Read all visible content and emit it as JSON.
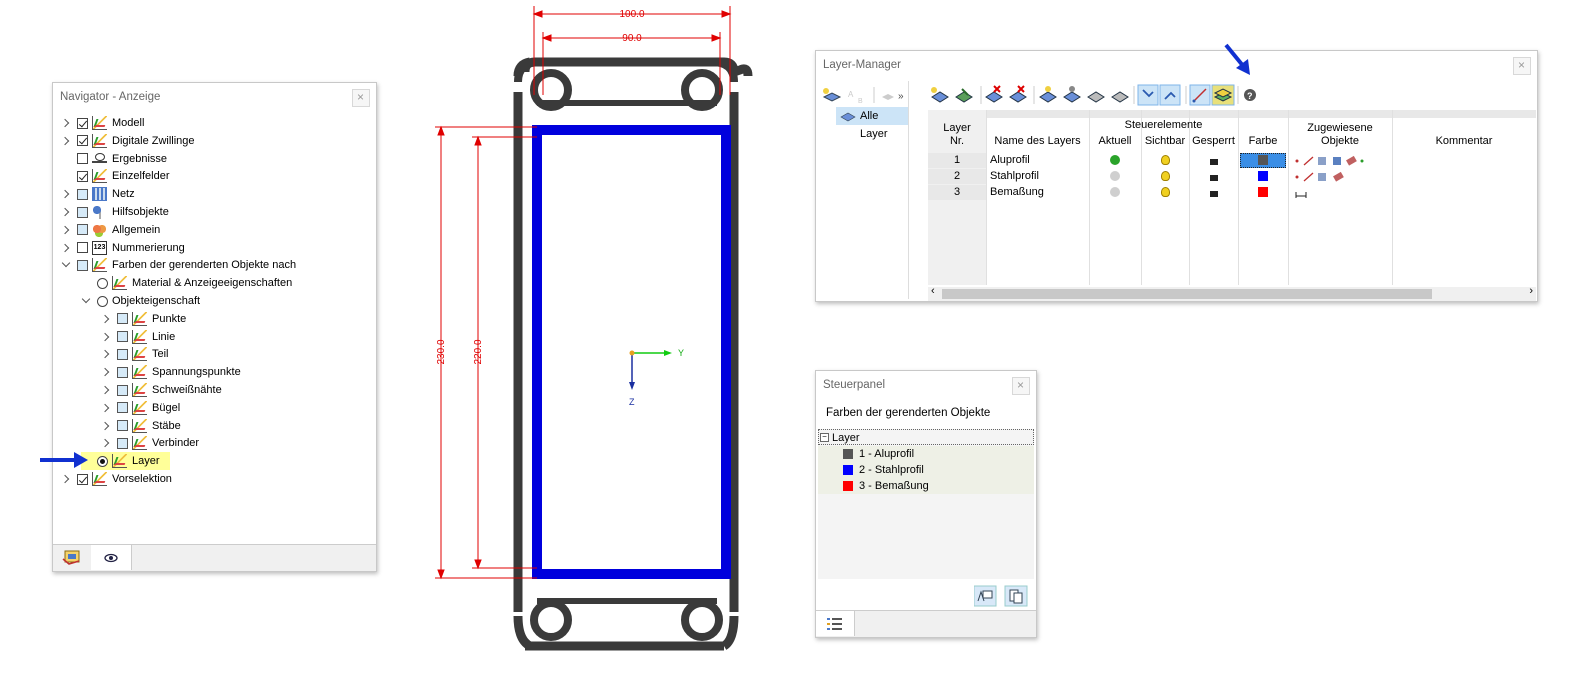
{
  "navigator": {
    "title": "Navigator - Anzeige",
    "items": [
      {
        "label": "Modell",
        "level": 0,
        "expander": "right",
        "check": "checked",
        "icon": "model-icon"
      },
      {
        "label": "Digitale Zwillinge",
        "level": 0,
        "expander": "right",
        "check": "checked",
        "icon": "digital-twin-icon"
      },
      {
        "label": "Ergebnisse",
        "level": 0,
        "expander": "none",
        "check": "unchecked",
        "icon": "results-icon"
      },
      {
        "label": "Einzelfelder",
        "level": 0,
        "expander": "none",
        "check": "checked",
        "icon": "fields-icon"
      },
      {
        "label": "Netz",
        "level": 0,
        "expander": "right",
        "check": "partial",
        "icon": "mesh-icon"
      },
      {
        "label": "Hilfsobjekte",
        "level": 0,
        "expander": "right",
        "check": "partial",
        "icon": "helper-objects-icon"
      },
      {
        "label": "Allgemein",
        "level": 0,
        "expander": "right",
        "check": "partial",
        "icon": "general-icon"
      },
      {
        "label": "Nummerierung",
        "level": 0,
        "expander": "right",
        "check": "unchecked",
        "icon": "numbering-icon"
      },
      {
        "label": "Farben der gerenderten Objekte nach",
        "level": 0,
        "expander": "down",
        "check": "partial",
        "icon": "render-colors-icon"
      },
      {
        "label": "Material & Anzeigeeigenschaften",
        "level": 1,
        "expander": "none",
        "radio": "off",
        "icon": "material-icon"
      },
      {
        "label": "Objekteigenschaft",
        "level": 1,
        "expander": "down",
        "radio": "off",
        "icon": "none"
      },
      {
        "label": "Punkte",
        "level": 2,
        "expander": "right",
        "check": "partial",
        "icon": "points-icon"
      },
      {
        "label": "Linie",
        "level": 2,
        "expander": "right",
        "check": "partial",
        "icon": "line-icon"
      },
      {
        "label": "Teil",
        "level": 2,
        "expander": "right",
        "check": "partial",
        "icon": "part-icon"
      },
      {
        "label": "Spannungspunkte",
        "level": 2,
        "expander": "right",
        "check": "partial",
        "icon": "stress-points-icon"
      },
      {
        "label": "Schweißnähte",
        "level": 2,
        "expander": "right",
        "check": "partial",
        "icon": "welds-icon"
      },
      {
        "label": "Bügel",
        "level": 2,
        "expander": "right",
        "check": "partial",
        "icon": "stirrups-icon"
      },
      {
        "label": "Stäbe",
        "level": 2,
        "expander": "right",
        "check": "partial",
        "icon": "bars-icon"
      },
      {
        "label": "Verbinder",
        "level": 2,
        "expander": "right",
        "check": "partial",
        "icon": "connectors-icon"
      },
      {
        "label": "Layer",
        "level": 1,
        "expander": "none",
        "radio": "on",
        "icon": "layer-icon",
        "highlighted": true
      },
      {
        "label": "Vorselektion",
        "level": 0,
        "expander": "right",
        "check": "checked",
        "icon": "preselection-icon"
      }
    ]
  },
  "drawing": {
    "dim_top_outer": "100.0",
    "dim_top_inner": "90.0",
    "dim_left_outer": "230.0",
    "dim_left_inner": "220.0",
    "axis_y": "Y",
    "axis_z": "Z",
    "colors": {
      "profile": "#3a3a3a",
      "rectangle": "#0000dd",
      "dimension": "#e00000",
      "axis_y": "#11cc11",
      "axis_z": "#1a2fa0"
    }
  },
  "layer_manager": {
    "title": "Layer-Manager",
    "tree_root": "Alle Layer",
    "headers": {
      "layer_nr_1": "Layer",
      "layer_nr_2": "Nr.",
      "name": "Name des Layers",
      "group": "Steuerelemente",
      "current": "Aktuell",
      "visible": "Sichtbar",
      "locked": "Gesperrt",
      "color": "Farbe",
      "assigned_1": "Zugewiesene",
      "assigned_2": "Objekte",
      "comment": "Kommentar"
    },
    "rows": [
      {
        "nr": "1",
        "name": "Aluprofil",
        "current": true,
        "color": "#555555"
      },
      {
        "nr": "2",
        "name": "Stahlprofil",
        "current": false,
        "color": "#0000ff"
      },
      {
        "nr": "3",
        "name": "Bemaßung",
        "current": false,
        "color": "#ff0000"
      }
    ]
  },
  "control_panel": {
    "title": "Steuerpanel",
    "subtitle": "Farben der gerenderten Objekte",
    "group": "Layer",
    "legend": [
      {
        "label": "1 - Aluprofil",
        "color": "#555555"
      },
      {
        "label": "2 - Stahlprofil",
        "color": "#0000ff"
      },
      {
        "label": "3 - Bemaßung",
        "color": "#ff0000"
      }
    ]
  }
}
